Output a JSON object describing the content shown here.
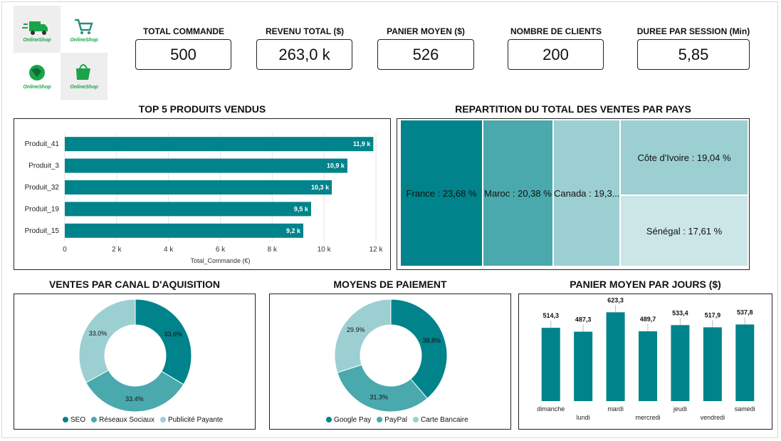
{
  "colors": {
    "teal_dark": "#00838a",
    "teal_mid": "#4aa9ad",
    "teal_light": "#9ccfd2",
    "teal_pale": "#cce6e8",
    "logo_green": "#1aa34a"
  },
  "logos": [
    {
      "text": "OnlineShop",
      "icon": "delivery-truck-icon"
    },
    {
      "text": "OnlineShop",
      "icon": "shopping-cart-icon"
    },
    {
      "text": "OnlineShop",
      "icon": "globe-icon"
    },
    {
      "text": "OnlineShop",
      "icon": "shopping-bag-icon"
    }
  ],
  "kpis": [
    {
      "title": "TOTAL COMMANDE",
      "value": "500"
    },
    {
      "title": "REVENU TOTAL ($)",
      "value": "263,0 k"
    },
    {
      "title": "PANIER MOYEN ($)",
      "value": "526"
    },
    {
      "title": "NOMBRE DE CLIENTS",
      "value": "200"
    },
    {
      "title": "DUREE PAR SESSION (Min)",
      "value": "5,85"
    }
  ],
  "chart_data": [
    {
      "type": "bar",
      "orientation": "horizontal",
      "title": "TOP 5 PRODUITS VENDUS",
      "categories": [
        "Produit_41",
        "Produit_3",
        "Produit_32",
        "Produit_19",
        "Produit_15"
      ],
      "values": [
        11.9,
        10.9,
        10.3,
        9.5,
        9.2
      ],
      "data_labels": [
        "11,9 k",
        "10,9 k",
        "10,3 k",
        "9,5 k",
        "9,2 k"
      ],
      "xlabel": "Total_Commande (€)",
      "xlim": [
        0,
        12
      ],
      "xticks": [
        0,
        2,
        4,
        6,
        8,
        10,
        12
      ],
      "xtick_labels": [
        "0",
        "2 k",
        "4 k",
        "6 k",
        "8 k",
        "10 k",
        "12 k"
      ],
      "grid": true
    },
    {
      "type": "treemap",
      "title": "REPARTITION DU TOTAL DES VENTES PAR PAYS",
      "categories": [
        "France",
        "Maroc",
        "Canada",
        "Côte d'Ivoire",
        "Sénégal"
      ],
      "values": [
        23.68,
        20.38,
        19.3,
        19.04,
        17.61
      ],
      "labels": [
        "France : 23,68 %",
        "Maroc : 20,38 %",
        "Canada : 19,3...",
        "Côte d'Ivoire : 19,04 %",
        "Sénégal : 17,61 %"
      ]
    },
    {
      "type": "pie",
      "donut": true,
      "title": "VENTES PAR CANAL D'AQUISITION",
      "categories": [
        "SEO",
        "Réseaux Sociaux",
        "Publicité Payante"
      ],
      "values": [
        33.6,
        33.4,
        33.0
      ],
      "data_labels": [
        "33.6%",
        "33.4%",
        "33.0%"
      ],
      "legend": "bottom"
    },
    {
      "type": "pie",
      "donut": true,
      "title": "MOYENS DE PAIEMENT",
      "categories": [
        "Google Pay",
        "PayPal",
        "Carte Bancaire"
      ],
      "values": [
        38.8,
        31.3,
        29.9
      ],
      "data_labels": [
        "38.8%",
        "31.3%",
        "29.9%"
      ],
      "legend": "bottom"
    },
    {
      "type": "bar",
      "title": "PANIER MOYEN PAR JOURS ($)",
      "categories": [
        "dimanche",
        "lundi",
        "mardi",
        "mercredi",
        "jeudi",
        "vendredi",
        "samedi"
      ],
      "values": [
        514.3,
        487.3,
        623.3,
        489.7,
        533.4,
        517.9,
        537.8
      ],
      "data_labels": [
        "514,3",
        "487,3",
        "623,3",
        "489,7",
        "533,4",
        "517,9",
        "537,8"
      ],
      "ylim": [
        0,
        700
      ],
      "grid": false
    }
  ]
}
